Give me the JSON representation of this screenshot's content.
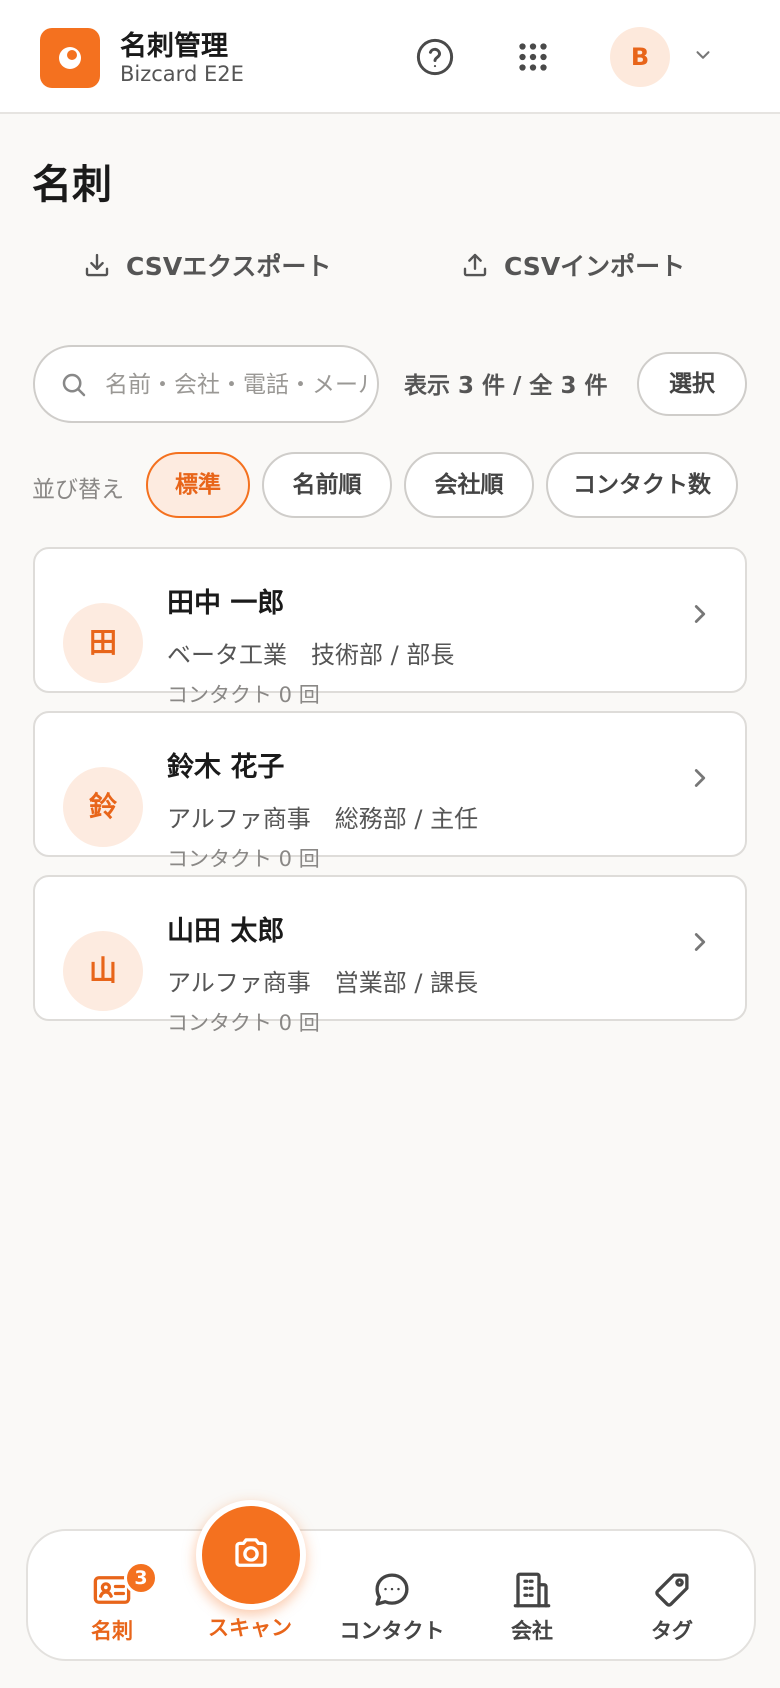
{
  "header": {
    "app_title": "名刺管理",
    "app_subtitle": "Bizcard E2E",
    "avatar_initial": "B"
  },
  "page": {
    "title": "名刺"
  },
  "actions": {
    "csv_export": "CSVエクスポート",
    "csv_import": "CSVインポート"
  },
  "search": {
    "placeholder": "名前・会社・電話・メール",
    "value": ""
  },
  "result_count": "表示 3 件 / 全 3 件",
  "select_label": "選択",
  "sort": {
    "label": "並び替え",
    "options": [
      "標準",
      "名前順",
      "会社順",
      "コンタクト数"
    ],
    "selected": "標準"
  },
  "cards": [
    {
      "initial": "田",
      "name": "田中 一郎",
      "org": "ベータ工業　技術部 / 部長",
      "contact": "コンタクト 0 回"
    },
    {
      "initial": "鈴",
      "name": "鈴木 花子",
      "org": "アルファ商事　総務部 / 主任",
      "contact": "コンタクト 0 回"
    },
    {
      "initial": "山",
      "name": "山田 太郎",
      "org": "アルファ商事　営業部 / 課長",
      "contact": "コンタクト 0 回"
    }
  ],
  "nav": {
    "cards_label": "名刺",
    "cards_badge": "3",
    "scan_label": "スキャン",
    "contact_label": "コンタクト",
    "company_label": "会社",
    "tags_label": "タグ"
  },
  "colors": {
    "accent": "#f4711f",
    "accent_text": "#e8651a",
    "accent_soft": "#fdebe0",
    "background": "#faf9f7"
  },
  "icons": [
    "logo-icon",
    "help-icon",
    "apps-grid-icon",
    "chevron-down-icon",
    "download-icon",
    "upload-icon",
    "search-icon",
    "chevron-right-icon",
    "business-card-icon",
    "camera-icon",
    "chat-bubble-icon",
    "building-icon",
    "tag-icon"
  ]
}
